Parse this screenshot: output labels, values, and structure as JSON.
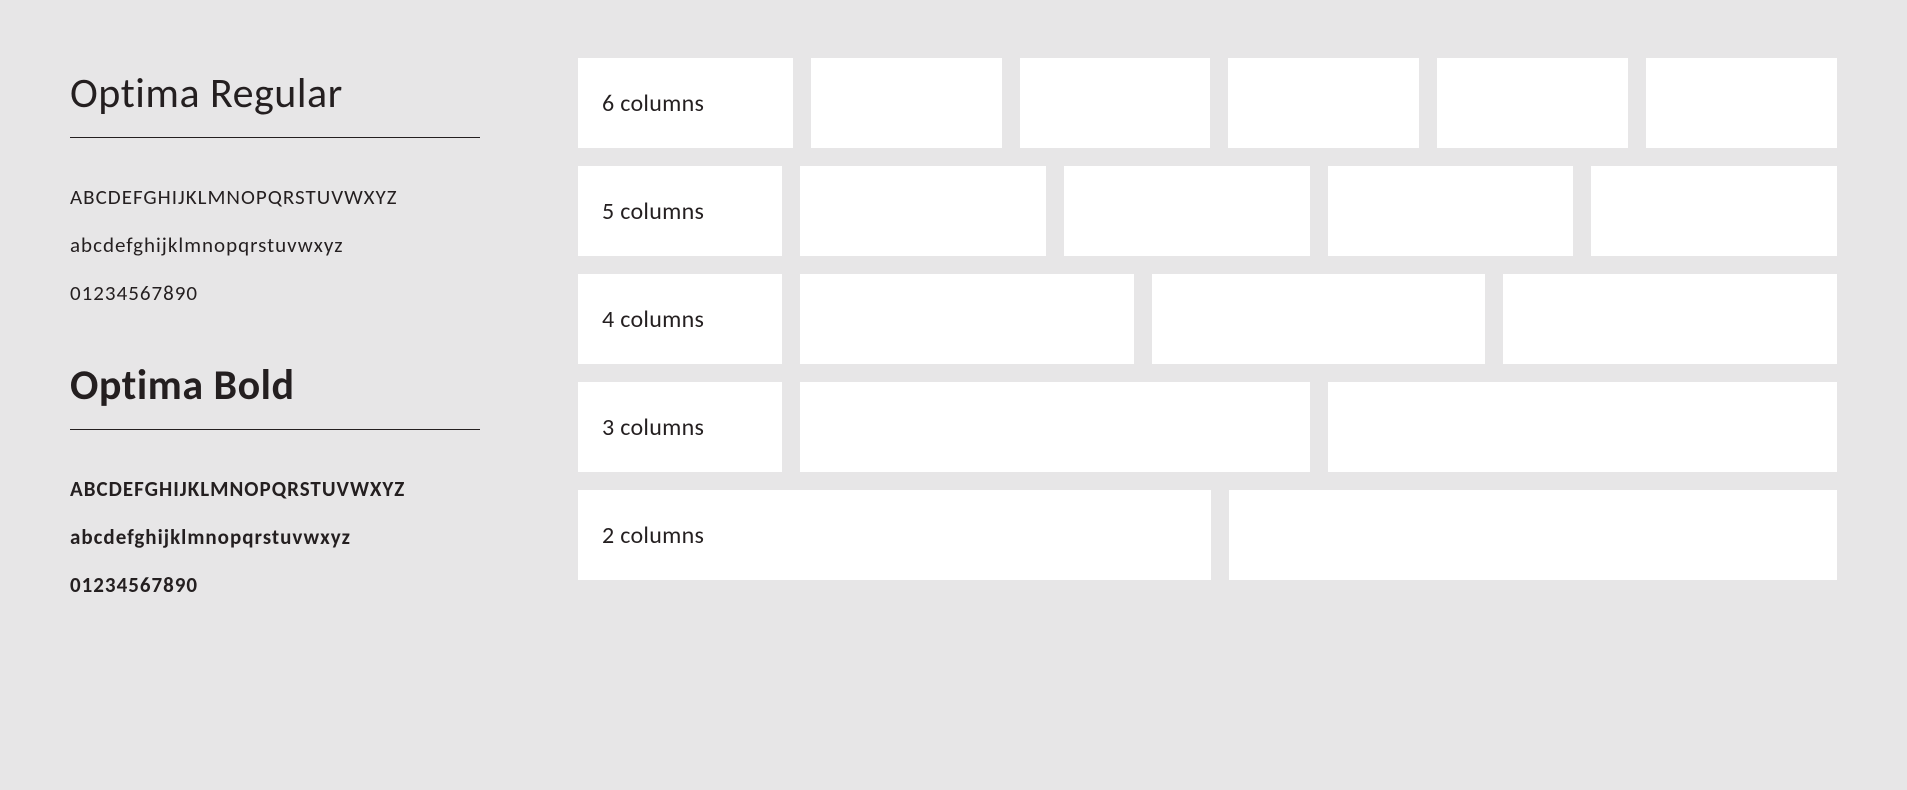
{
  "typography": {
    "blocks": [
      {
        "title": "Optima Regular",
        "bold": false,
        "specimens": [
          "ABCDEFGHIJKLMNOPQRSTUVWXYZ",
          "abcdefghijklmnopqrstuvwxyz",
          "01234567890"
        ]
      },
      {
        "title": "Optima Bold",
        "bold": true,
        "specimens": [
          "ABCDEFGHIJKLMNOPQRSTUVWXYZ",
          "abcdefghijklmnopqrstuvwxyz",
          "01234567890"
        ]
      }
    ]
  },
  "grid_demo": {
    "rows": [
      {
        "columns": 6,
        "label": "6 columns"
      },
      {
        "columns": 5,
        "label": "5 columns"
      },
      {
        "columns": 4,
        "label": "4 columns"
      },
      {
        "columns": 3,
        "label": "3 columns"
      },
      {
        "columns": 2,
        "label": "2 columns"
      }
    ]
  },
  "colors": {
    "background": "#e7e6e7",
    "cell": "#ffffff",
    "text": "#241f20"
  }
}
